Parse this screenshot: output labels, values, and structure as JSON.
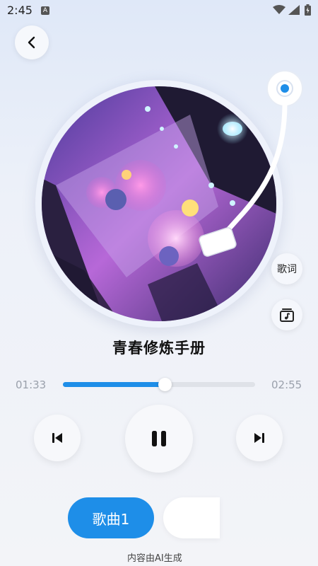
{
  "status_bar": {
    "time": "2:45",
    "badge": "A"
  },
  "header": {
    "back_icon": "chevron-left-icon"
  },
  "player": {
    "title": "青春修炼手册",
    "current_time": "01:33",
    "total_time": "02:55",
    "progress": 0.53,
    "lyrics_label": "歌词"
  },
  "controls": {
    "prev_icon": "skip-previous-icon",
    "play_icon": "pause-icon",
    "next_icon": "skip-next-icon"
  },
  "playlist": {
    "song_chip": "歌曲1"
  },
  "footer": {
    "ai_notice": "内容由AI生成"
  },
  "colors": {
    "accent": "#1e8ee8",
    "background": "#eef2f9"
  }
}
